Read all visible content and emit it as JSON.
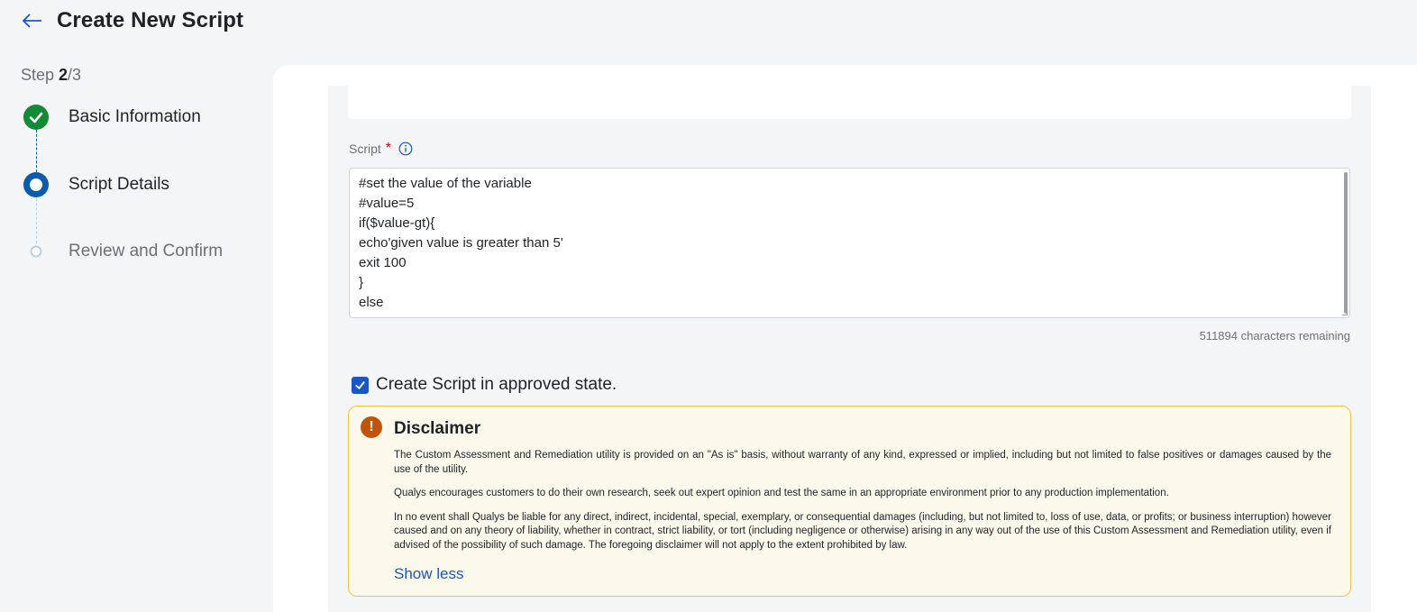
{
  "header": {
    "title": "Create New Script",
    "back_icon": "arrow-left-icon"
  },
  "stepper": {
    "step_prefix": "Step ",
    "current": "2",
    "total": "/3",
    "steps": [
      {
        "label": "Basic Information",
        "state": "completed"
      },
      {
        "label": "Script Details",
        "state": "active"
      },
      {
        "label": "Review and Confirm",
        "state": "pending"
      }
    ]
  },
  "script": {
    "label": "Script",
    "required_mark": "*",
    "lines": [
      "#set the value of the variable",
      "#value=5",
      "if($value-gt){",
      "echo'given value is greater than 5'",
      "exit 100",
      "}",
      "else"
    ],
    "chars_remaining": "511894 characters remaining"
  },
  "approve": {
    "checked": true,
    "label": "Create Script in approved state."
  },
  "disclaimer": {
    "icon": "exclamation-icon",
    "title": "Disclaimer",
    "paragraphs": [
      "The Custom Assessment and Remediation utility is provided on an \"As is\" basis, without warranty of any kind, expressed or implied, including but not limited to false positives or damages caused by the use of the utility.",
      "Qualys encourages customers to do their own research, seek out expert opinion and test the same in an appropriate environment prior to any production implementation.",
      "In no event shall Qualys be liable for any direct, indirect, incidental, special, exemplary, or consequential damages (including, but not limited to, loss of use, data, or profits; or business interruption) however caused and on any theory of liability, whether in contract, strict liability, or tort (including negligence or otherwise) arising in any way out of the use of this Custom Assessment and Remediation utility, even if advised of the possibility of such damage. The foregoing disclaimer will not apply to the extent prohibited by law."
    ],
    "toggle_label": "Show less"
  },
  "colors": {
    "accent": "#1a56c4",
    "success": "#138a36",
    "active": "#0b5cab",
    "warning": "#c2530a",
    "warning_border": "#f6c443",
    "required": "#d0021b"
  }
}
